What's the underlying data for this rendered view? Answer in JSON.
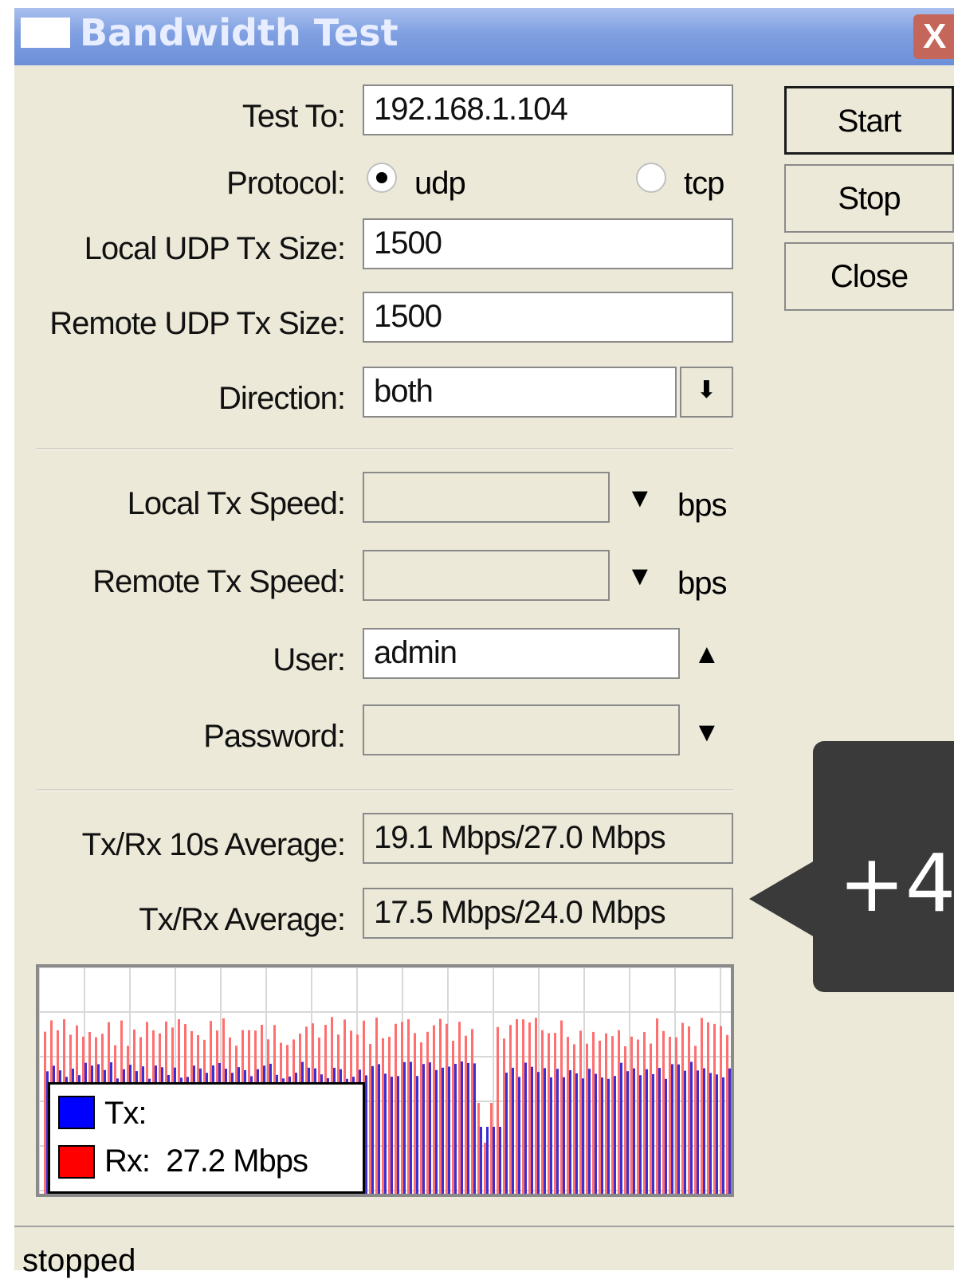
{
  "window": {
    "title": "Bandwidth Test",
    "close_glyph": "X"
  },
  "form": {
    "test_to": {
      "label": "Test To:",
      "value": "192.168.1.104"
    },
    "protocol": {
      "label": "Protocol:",
      "options": [
        "udp",
        "tcp"
      ],
      "selected": "udp"
    },
    "local_udp_tx_size": {
      "label": "Local UDP Tx Size:",
      "value": "1500"
    },
    "remote_udp_tx_size": {
      "label": "Remote UDP Tx Size:",
      "value": "1500"
    },
    "direction": {
      "label": "Direction:",
      "value": "both"
    },
    "local_tx_speed": {
      "label": "Local Tx Speed:",
      "value": "",
      "unit": "bps"
    },
    "remote_tx_speed": {
      "label": "Remote Tx Speed:",
      "value": "",
      "unit": "bps"
    },
    "user": {
      "label": "User:",
      "value": "admin"
    },
    "password": {
      "label": "Password:",
      "value": ""
    },
    "tx_rx_10s_average": {
      "label": "Tx/Rx 10s Average:",
      "value": "19.1 Mbps/27.0 Mbps"
    },
    "tx_rx_average": {
      "label": "Tx/Rx Average:",
      "value": "17.5 Mbps/24.0 Mbps"
    }
  },
  "buttons": {
    "start": "Start",
    "stop": "Stop",
    "close": "Close"
  },
  "graph": {
    "legend": {
      "tx": "Tx:",
      "rx": "Rx:  27.2 Mbps"
    },
    "colors": {
      "tx": "#0000ff",
      "rx": "#ff0000"
    }
  },
  "status": "stopped",
  "callout": {
    "text": "+4"
  },
  "icons": [
    "window-icon",
    "close-icon",
    "dropdown-icon",
    "chevron-down-icon",
    "chevron-up-icon"
  ]
}
